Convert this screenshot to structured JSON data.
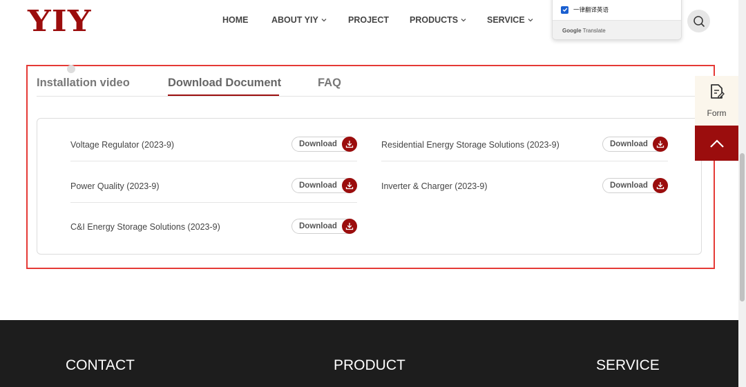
{
  "header": {
    "logo": "YIY",
    "nav": [
      {
        "label": "HOME",
        "dropdown": false
      },
      {
        "label": "ABOUT YIY",
        "dropdown": true
      },
      {
        "label": "PROJECT",
        "dropdown": false
      },
      {
        "label": "PRODUCTS",
        "dropdown": true
      },
      {
        "label": "SERVICE",
        "dropdown": true
      }
    ],
    "translate_popup": {
      "option_label": "一律翻译英语",
      "option_checked": true,
      "footer_brand": "Google",
      "footer_text": "Translate"
    },
    "search_icon": "search-icon"
  },
  "tabs": [
    {
      "label": "Installation video",
      "active": false
    },
    {
      "label": "Download Document",
      "active": true
    },
    {
      "label": "FAQ",
      "active": false
    }
  ],
  "documents": [
    {
      "title": "Voltage Regulator (2023-9)",
      "button": "Download"
    },
    {
      "title": "Residential Energy Storage Solutions (2023-9)",
      "button": "Download"
    },
    {
      "title": "Power Quality (2023-9)",
      "button": "Download"
    },
    {
      "title": "Inverter & Charger (2023-9)",
      "button": "Download"
    },
    {
      "title": "C&I Energy Storage Solutions (2023-9)",
      "button": "Download"
    }
  ],
  "floats": {
    "form_label": "Form",
    "form_icon": "document-edit-icon",
    "top_icon": "chevron-up-icon"
  },
  "footer": {
    "contact": "CONTACT",
    "product": "PRODUCT",
    "service": "SERVICE"
  },
  "colors": {
    "brand": "#9b0d0d",
    "highlight_border": "#e53935",
    "footer_bg": "#1d1d1d"
  }
}
